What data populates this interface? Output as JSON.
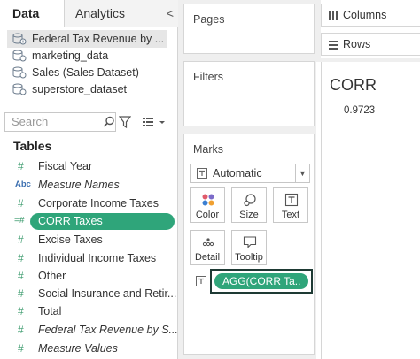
{
  "tabs": {
    "data": "Data",
    "analytics": "Analytics",
    "collapse": "<"
  },
  "datasources": [
    {
      "label": "Federal Tax Revenue by ...",
      "selected": true
    },
    {
      "label": "marketing_data",
      "selected": false
    },
    {
      "label": "Sales (Sales Dataset)",
      "selected": false
    },
    {
      "label": "superstore_dataset",
      "selected": false
    }
  ],
  "search": {
    "placeholder": "Search"
  },
  "tables_heading": "Tables",
  "fields": [
    {
      "type": "#",
      "label": "Fiscal Year"
    },
    {
      "type": "Abc",
      "label": "Measure Names"
    },
    {
      "type": "#",
      "label": "Corporate Income Taxes"
    },
    {
      "type": "=#",
      "label": "CORR Taxes"
    },
    {
      "type": "#",
      "label": "Excise Taxes"
    },
    {
      "type": "#",
      "label": "Individual Income Taxes"
    },
    {
      "type": "#",
      "label": "Other"
    },
    {
      "type": "#",
      "label": "Social Insurance and Retir..."
    },
    {
      "type": "#",
      "label": "Total"
    },
    {
      "type": "#",
      "label": "Federal Tax Revenue by S..."
    },
    {
      "type": "#",
      "label": "Measure Values"
    }
  ],
  "shelves": {
    "pages": "Pages",
    "filters": "Filters",
    "marks": "Marks",
    "columns": "Columns",
    "rows": "Rows"
  },
  "marks": {
    "type": "Automatic",
    "buttons": {
      "color": "Color",
      "size": "Size",
      "text": "Text",
      "detail": "Detail",
      "tooltip": "Tooltip"
    },
    "text_pill": "AGG(CORR Ta.."
  },
  "viz": {
    "header": "CORR",
    "value": "0.9723"
  },
  "colors": {
    "accent_green": "#2fa57a",
    "pane_gray": "#efefef"
  }
}
